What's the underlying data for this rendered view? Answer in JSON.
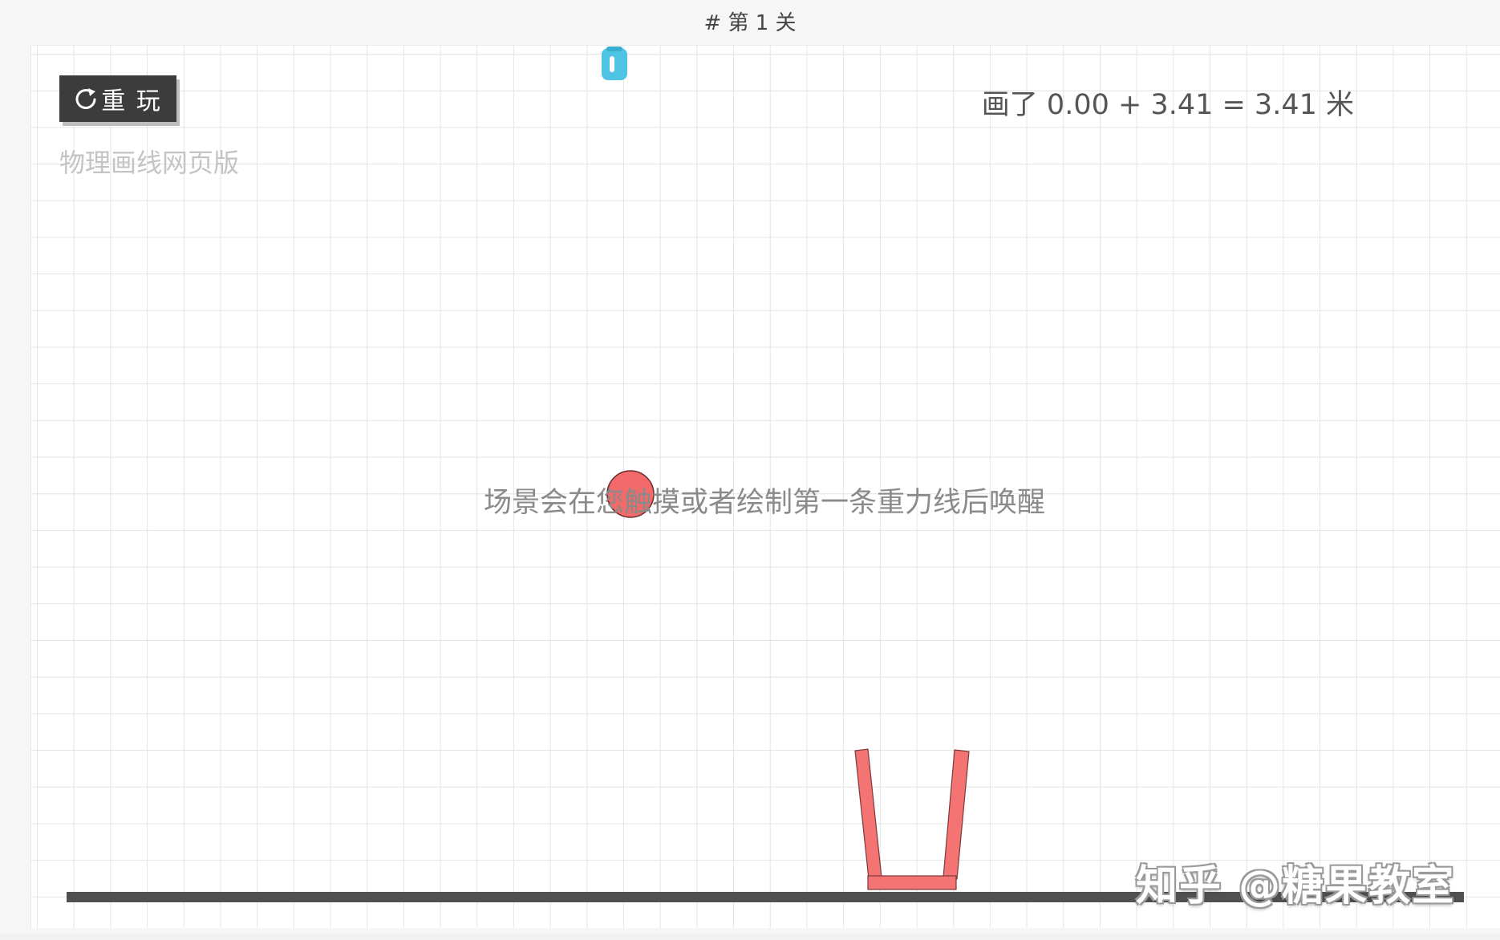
{
  "level": {
    "title": "# 第 1 关"
  },
  "toolbar": {
    "replay_label": "重 玩",
    "replay_icon": "refresh-icon"
  },
  "app": {
    "subtitle": "物理画线网页版"
  },
  "stats": {
    "length_text": "画了 0.00 + 3.41 = 3.41 米"
  },
  "hint": {
    "text": "场景会在您触摸或者绘制第一条重力线后唤醒"
  },
  "watermark": {
    "text": "知乎 @糖果教室"
  },
  "colors": {
    "ball": "#f26a6a",
    "cup": "#f47474",
    "ground": "#505050",
    "pen": "#4fc3e3",
    "button_bg": "#3c3c3c"
  },
  "pen": {
    "icon": "pen-icon"
  }
}
